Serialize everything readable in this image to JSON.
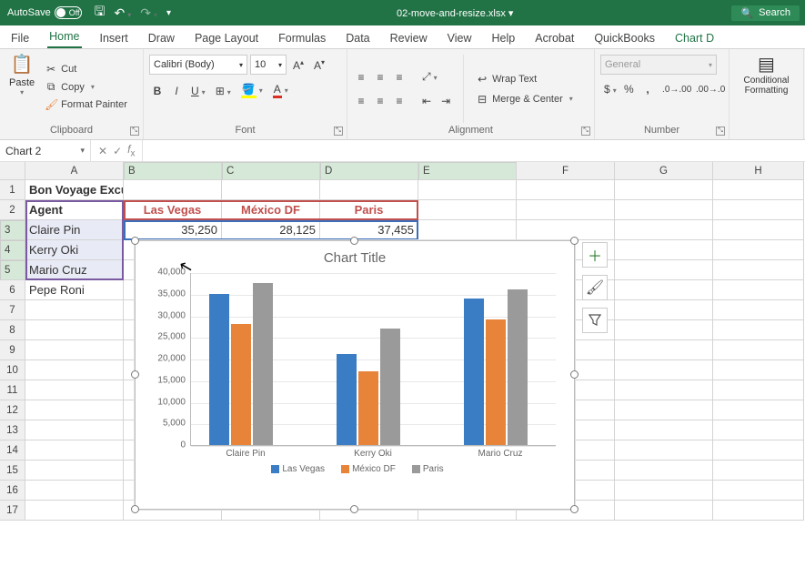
{
  "titlebar": {
    "autosave_label": "AutoSave",
    "autosave_state": "Off",
    "filename": "02-move-and-resize.xlsx ▾",
    "search_label": "Search"
  },
  "tabs": [
    "File",
    "Home",
    "Insert",
    "Draw",
    "Page Layout",
    "Formulas",
    "Data",
    "Review",
    "View",
    "Help",
    "Acrobat",
    "QuickBooks",
    "Chart D"
  ],
  "ribbon": {
    "clipboard": {
      "label": "Clipboard",
      "paste": "Paste",
      "cut": "Cut",
      "copy": "Copy",
      "format_painter": "Format Painter"
    },
    "font": {
      "label": "Font",
      "name": "Calibri (Body)",
      "size": "10"
    },
    "alignment": {
      "label": "Alignment",
      "wrap": "Wrap Text",
      "merge": "Merge & Center"
    },
    "number": {
      "label": "Number",
      "format": "General"
    },
    "cond": {
      "label": "Conditional Formatting"
    }
  },
  "namebox": "Chart 2",
  "columns": [
    "A",
    "B",
    "C",
    "D",
    "E",
    "F",
    "G",
    "H"
  ],
  "sheet": {
    "a1": "Bon Voyage Excursions",
    "a2": "Agent",
    "b2": "Las Vegas",
    "c2": "México DF",
    "d2": "Paris",
    "a3": "Claire Pin",
    "b3": "35,250",
    "c3": "28,125",
    "d3": "37,455",
    "a4": "Kerry Oki",
    "a5": "Mario Cruz",
    "a6": "Pepe Roni"
  },
  "chart_data": {
    "type": "bar",
    "title": "Chart Title",
    "categories": [
      "Claire Pin",
      "Kerry Oki",
      "Mario Cruz"
    ],
    "series": [
      {
        "name": "Las Vegas",
        "values": [
          35000,
          21000,
          34000
        ],
        "color": "#3b7dc4"
      },
      {
        "name": "México DF",
        "values": [
          28000,
          17000,
          29000
        ],
        "color": "#e8833a"
      },
      {
        "name": "Paris",
        "values": [
          37500,
          27000,
          36000
        ],
        "color": "#9a9a9a"
      }
    ],
    "ylim": [
      0,
      40000
    ],
    "yticks": [
      0,
      5000,
      10000,
      15000,
      20000,
      25000,
      30000,
      35000,
      40000
    ],
    "ytick_labels": [
      "0",
      "5,000",
      "10,000",
      "15,000",
      "20,000",
      "25,000",
      "30,000",
      "35,000",
      "40,000"
    ]
  }
}
